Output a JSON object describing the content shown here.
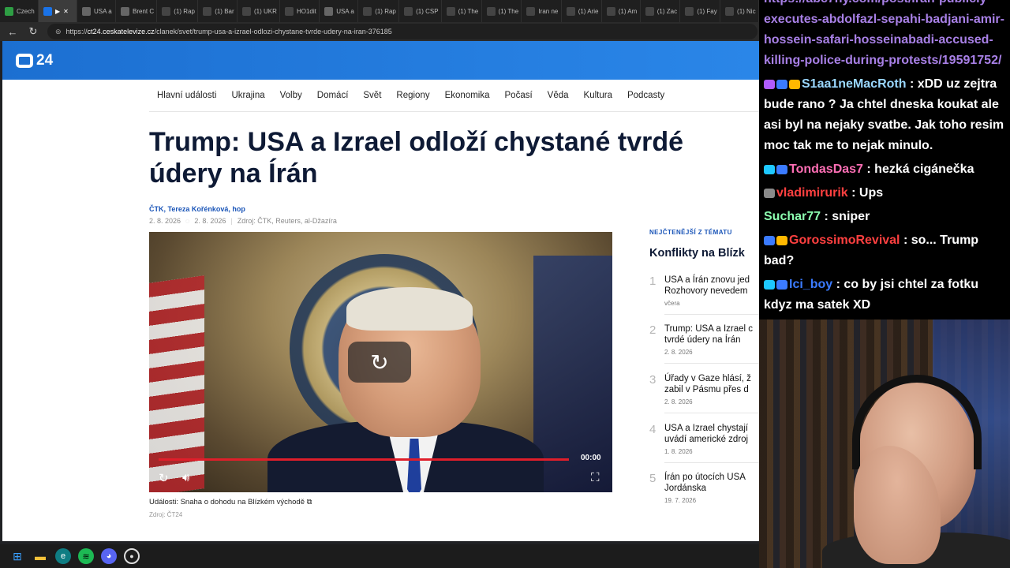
{
  "browser": {
    "tabs": [
      {
        "label": "Czech",
        "icon": "green-x-icon",
        "color": "#2e9e44",
        "active": false
      },
      {
        "label": "▶",
        "icon": "media-tab-icon",
        "color": "#1a73e8",
        "active": true
      },
      {
        "label": "USA a",
        "icon": "ct24-icon",
        "color": "#666666",
        "active": false
      },
      {
        "label": "Brent C",
        "icon": "globe-icon",
        "color": "#666666",
        "active": false
      },
      {
        "label": "(1) Rap",
        "icon": "x-icon",
        "color": "#444444",
        "active": false
      },
      {
        "label": "(1) Bar",
        "icon": "x-icon",
        "color": "#444444",
        "active": false
      },
      {
        "label": "(1) UKR",
        "icon": "x-icon",
        "color": "#444444",
        "active": false
      },
      {
        "label": "HO1dit",
        "icon": "x-icon",
        "color": "#444444",
        "active": false
      },
      {
        "label": "USA a",
        "icon": "ct24-icon",
        "color": "#666666",
        "active": false
      },
      {
        "label": "(1) Rap",
        "icon": "x-icon",
        "color": "#444444",
        "active": false
      },
      {
        "label": "(1) CSP",
        "icon": "x-icon",
        "color": "#444444",
        "active": false
      },
      {
        "label": "(1) The",
        "icon": "x-icon",
        "color": "#444444",
        "active": false
      },
      {
        "label": "(1) The",
        "icon": "x-icon",
        "color": "#444444",
        "active": false
      },
      {
        "label": "Iran ne",
        "icon": "news-icon",
        "color": "#444444",
        "active": false
      },
      {
        "label": "(1) Arie",
        "icon": "x-icon",
        "color": "#444444",
        "active": false
      },
      {
        "label": "(1) Am",
        "icon": "x-icon",
        "color": "#444444",
        "active": false
      },
      {
        "label": "(1) Zac",
        "icon": "x-icon",
        "color": "#444444",
        "active": false
      },
      {
        "label": "(1) Fay",
        "icon": "x-icon",
        "color": "#444444",
        "active": false
      },
      {
        "label": "(1) Nic",
        "icon": "x-icon",
        "color": "#444444",
        "active": false
      }
    ],
    "url_prefix": "https://",
    "url_host": "ct24.ceskatelevize.cz",
    "url_path": "/clanek/svet/trump-usa-a-izrael-odlozi-chystane-tvrde-udery-na-iran-376185"
  },
  "site": {
    "logo_text": "24",
    "menu": [
      "Hlavní události",
      "Ukrajina",
      "Volby",
      "Domácí",
      "Svět",
      "Regiony",
      "Ekonomika",
      "Počasí",
      "Věda",
      "Kultura",
      "Podcasty"
    ]
  },
  "article": {
    "title": "Trump: USA a Izrael odloží chystané tvrdé údery na Írán",
    "authors": "ČTK, Tereza Kořénková, hop",
    "date_published": "2. 8. 2026",
    "date_updated": "2. 8. 2026",
    "source": "Zdroj: ČTK, Reuters, al-Džazíra",
    "video_time": "00:00",
    "video_progress": 1.0,
    "caption": "Události: Snaha o dohodu na Blízkém východě",
    "caption_source": "Zdroj: ČT24"
  },
  "sidebar": {
    "kicker": "NEJČTENĚJŠÍ Z TÉMATU",
    "title": "Konflikty na Blízk",
    "items": [
      {
        "num": "1",
        "line1": "USA a Írán znovu jed",
        "line2": "Rozhovory nevedem",
        "date": "včera"
      },
      {
        "num": "2",
        "line1": "Trump: USA a Izrael c",
        "line2": "tvrdé údery na Írán",
        "date": "2. 8. 2026"
      },
      {
        "num": "3",
        "line1": "Úřady v Gaze hlásí, ž",
        "line2": "zabil v Pásmu přes d",
        "date": "2. 8. 2026"
      },
      {
        "num": "4",
        "line1": "USA a Izrael chystají",
        "line2": "uvádí americké zdroj",
        "date": "1. 8. 2026"
      },
      {
        "num": "5",
        "line1": "Írán po útocích USA",
        "line2": "Jordánska",
        "date": "19. 7. 2026"
      }
    ]
  },
  "chat": {
    "link_lines": [
      "https://abc7ny.com/post/iran-publicly-",
      "executes-abdolfazl-sepahi-badjani-amir-",
      "hossein-safari-hosseinabadi-accused-",
      "killing-police-during-protests/19591752/"
    ],
    "messages": [
      {
        "user": "S1aa1neMacRoth",
        "color": "#9ad7ff",
        "text": ": xDD uz zejtra bude rano ? Ja chtel dneska koukat ale asi byl na nejaky svatbe. Jak toho resim moc tak me to nejak minulo."
      },
      {
        "user": "TondasDas7",
        "color": "#ff6fb5",
        "text": ": hezká cigánečka"
      },
      {
        "user": "vladimirurik",
        "color": "#ff4040",
        "text": ": Ups"
      },
      {
        "user": "Suchar77",
        "color": "#8cffb0",
        "text": ": sniper"
      },
      {
        "user": "GorossimoRevival",
        "color": "#ff4040",
        "text": ": so... Trump bad?"
      },
      {
        "user": "Ici_boy",
        "color": "#3b7bff",
        "text": ": co by jsi chtel za fotku kdyz ma satek XD"
      }
    ]
  },
  "taskbar": [
    "windows-start-icon",
    "file-explorer-icon",
    "edge-icon",
    "spotify-icon",
    "discord-icon",
    "obs-icon"
  ]
}
